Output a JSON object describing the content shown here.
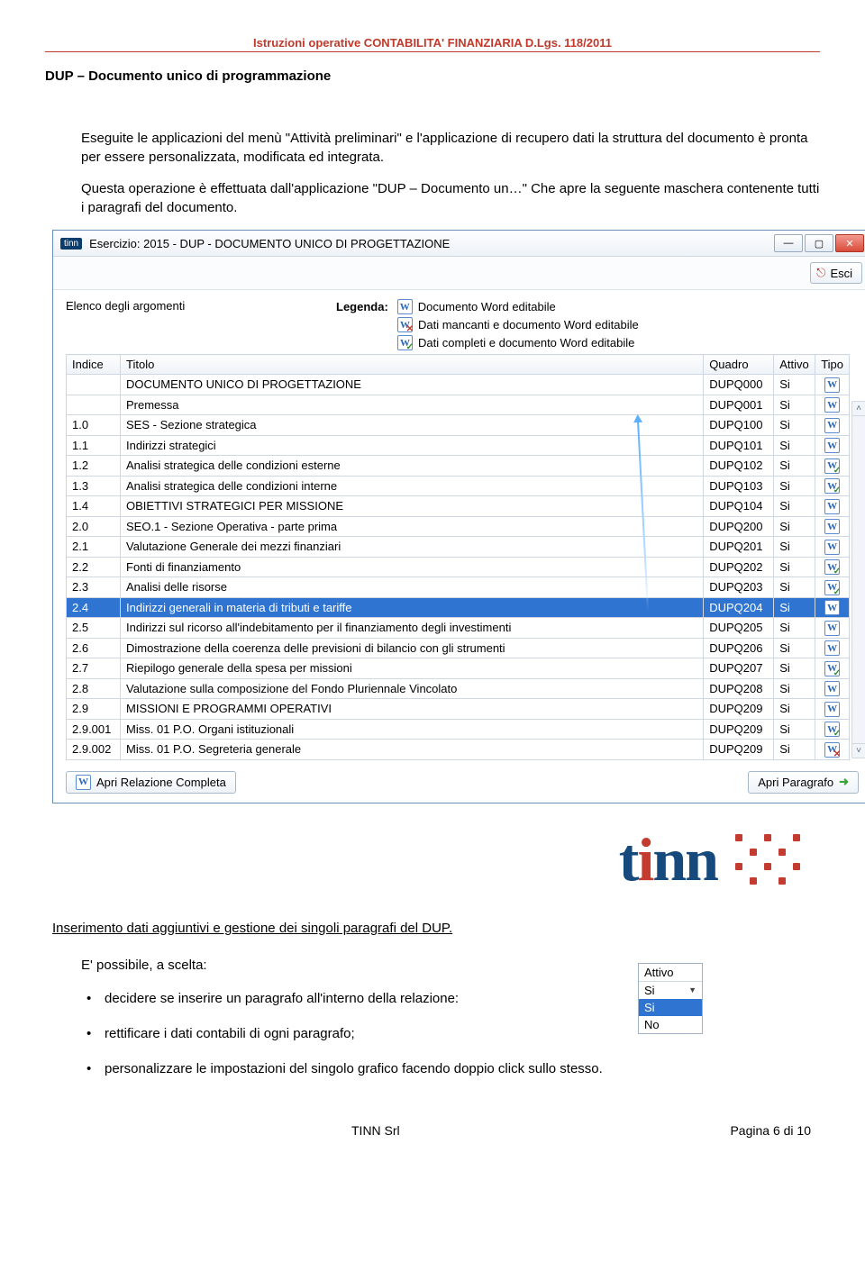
{
  "doc": {
    "header": "Istruzioni operative CONTABILITA' FINANZIARIA D.Lgs. 118/2011",
    "section_title": "DUP – Documento unico di programmazione",
    "para1": "Eseguite le applicazioni del menù \"Attività preliminari\" e l'applicazione di recupero dati la struttura del documento è pronta per essere personalizzata, modificata ed integrata.",
    "para2": "Questa operazione è effettuata dall'applicazione \"DUP – Documento un…\" Che apre la seguente maschera contenente tutti i paragrafi del documento.",
    "subheading": "Inserimento dati aggiuntivi e gestione dei singoli paragrafi del DUP.",
    "choice_intro": "E' possibile, a scelta:",
    "bullets": [
      "decidere se inserire un paragrafo all'interno della relazione:",
      "rettificare i dati contabili di ogni paragrafo;",
      "personalizzare le impostazioni del singolo grafico facendo doppio click sullo stesso."
    ],
    "footer_company": "TINN  Srl",
    "footer_page": "Pagina 6 di 10"
  },
  "window": {
    "title": "Esercizio: 2015 - DUP - DOCUMENTO UNICO DI PROGETTAZIONE",
    "esci": "Esci",
    "elenco": "Elenco degli argomenti",
    "legenda_label": "Legenda:",
    "legenda": [
      "Documento Word editabile",
      "Dati mancanti e documento Word editabile",
      "Dati completi e documento Word editabile"
    ],
    "columns": {
      "indice": "Indice",
      "titolo": "Titolo",
      "quadro": "Quadro",
      "attivo": "Attivo",
      "tipo": "Tipo"
    },
    "rows": [
      {
        "indice": "",
        "titolo": "DOCUMENTO UNICO DI PROGETTAZIONE",
        "quadro": "DUPQ000",
        "attivo": "Si",
        "tipo": "w"
      },
      {
        "indice": "",
        "titolo": "Premessa",
        "quadro": "DUPQ001",
        "attivo": "Si",
        "tipo": "w"
      },
      {
        "indice": "1.0",
        "titolo": "SES - Sezione strategica",
        "quadro": "DUPQ100",
        "attivo": "Si",
        "tipo": "w"
      },
      {
        "indice": "1.1",
        "titolo": "Indirizzi strategici",
        "quadro": "DUPQ101",
        "attivo": "Si",
        "tipo": "w"
      },
      {
        "indice": "1.2",
        "titolo": "Analisi strategica delle condizioni esterne",
        "quadro": "DUPQ102",
        "attivo": "Si",
        "tipo": "g"
      },
      {
        "indice": "1.3",
        "titolo": "Analisi strategica delle condizioni interne",
        "quadro": "DUPQ103",
        "attivo": "Si",
        "tipo": "g"
      },
      {
        "indice": "1.4",
        "titolo": "OBIETTIVI STRATEGICI PER MISSIONE",
        "quadro": "DUPQ104",
        "attivo": "Si",
        "tipo": "w"
      },
      {
        "indice": "2.0",
        "titolo": "SEO.1 - Sezione Operativa - parte prima",
        "quadro": "DUPQ200",
        "attivo": "Si",
        "tipo": "w"
      },
      {
        "indice": "2.1",
        "titolo": "Valutazione Generale dei mezzi finanziari",
        "quadro": "DUPQ201",
        "attivo": "Si",
        "tipo": "w"
      },
      {
        "indice": "2.2",
        "titolo": "Fonti di finanziamento",
        "quadro": "DUPQ202",
        "attivo": "Si",
        "tipo": "g"
      },
      {
        "indice": "2.3",
        "titolo": "Analisi delle risorse",
        "quadro": "DUPQ203",
        "attivo": "Si",
        "tipo": "g"
      },
      {
        "indice": "2.4",
        "titolo": "Indirizzi generali in materia di tributi e tariffe",
        "quadro": "DUPQ204",
        "attivo": "Si",
        "tipo": "w",
        "selected": true
      },
      {
        "indice": "2.5",
        "titolo": "Indirizzi sul ricorso all'indebitamento per il finanziamento degli investimenti",
        "quadro": "DUPQ205",
        "attivo": "Si",
        "tipo": "w"
      },
      {
        "indice": "2.6",
        "titolo": "Dimostrazione della coerenza delle previsioni di bilancio con gli strumenti",
        "quadro": "DUPQ206",
        "attivo": "Si",
        "tipo": "w"
      },
      {
        "indice": "2.7",
        "titolo": "Riepilogo generale della spesa per missioni",
        "quadro": "DUPQ207",
        "attivo": "Si",
        "tipo": "g"
      },
      {
        "indice": "2.8",
        "titolo": "Valutazione sulla composizione del Fondo Pluriennale Vincolato",
        "quadro": "DUPQ208",
        "attivo": "Si",
        "tipo": "w"
      },
      {
        "indice": "2.9",
        "titolo": "MISSIONI E PROGRAMMI OPERATIVI",
        "quadro": "DUPQ209",
        "attivo": "Si",
        "tipo": "w"
      },
      {
        "indice": "2.9.001",
        "titolo": "Miss. 01 P.O. Organi istituzionali",
        "quadro": "DUPQ209",
        "attivo": "Si",
        "tipo": "g"
      },
      {
        "indice": "2.9.002",
        "titolo": "Miss. 01 P.O. Segreteria generale",
        "quadro": "DUPQ209",
        "attivo": "Si",
        "tipo": "r"
      }
    ],
    "btn_left": "Apri Relazione Completa",
    "btn_right": "Apri Paragrafo"
  },
  "dropdown": {
    "header": "Attivo",
    "value": "Si",
    "options": [
      "Si",
      "No"
    ]
  }
}
